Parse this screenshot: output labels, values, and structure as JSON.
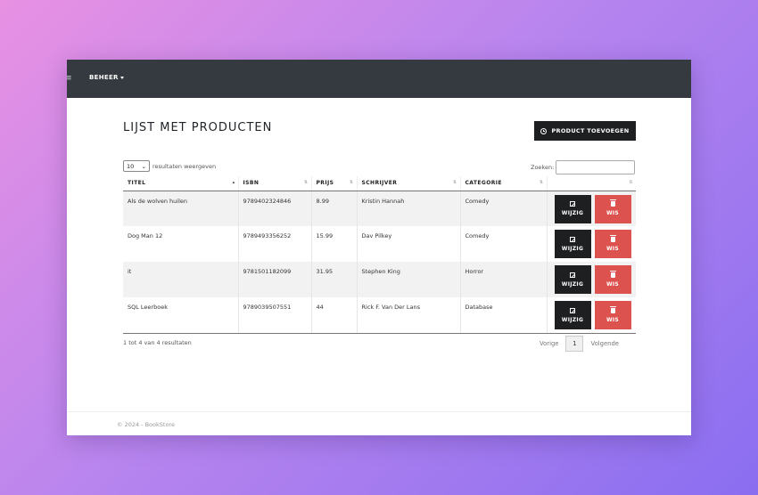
{
  "navbar": {
    "toggle_icon": "menu-icon",
    "toggle_symbol": "≡",
    "menu_label": "BEHEER"
  },
  "page": {
    "title": "LIJST MET PRODUCTEN",
    "add_button_label": "PRODUCT TOEVOEGEN",
    "add_button_icon": "plus-circle-icon"
  },
  "table_controls": {
    "length_value": "10",
    "length_suffix": "resultaten weergeven",
    "search_label": "Zoeken:",
    "search_value": ""
  },
  "columns": [
    "TITEL",
    "ISBN",
    "PRIJS",
    "SCHRIJVER",
    "CATEGORIE",
    ""
  ],
  "rows": [
    {
      "title": "Als de wolven huilen",
      "isbn": "9789402324846",
      "price": "8.99",
      "author": "Kristin Hannah",
      "category": "Comedy"
    },
    {
      "title": "Dog Man 12",
      "isbn": "9789493356252",
      "price": "15.99",
      "author": "Dav Pilkey",
      "category": "Comedy"
    },
    {
      "title": "it",
      "isbn": "9781501182099",
      "price": "31.95",
      "author": "Stephen King",
      "category": "Horror"
    },
    {
      "title": "SQL Leerboek",
      "isbn": "9789039507551",
      "price": "44",
      "author": "Rick F. Van Der Lans",
      "category": "Database"
    }
  ],
  "row_actions": {
    "edit_label": "WIJZIG",
    "delete_label": "WIS",
    "edit_icon": "edit-icon",
    "delete_icon": "trash-icon"
  },
  "pagination": {
    "info": "1 tot 4 van 4 resultaten",
    "previous": "Vorige",
    "current_page": "1",
    "next": "Volgende"
  },
  "footer": {
    "text": "© 2024 - BookStore"
  },
  "colors": {
    "navbar": "#343a40",
    "primary_button": "#1e1f21",
    "delete_button": "#dc524f"
  }
}
